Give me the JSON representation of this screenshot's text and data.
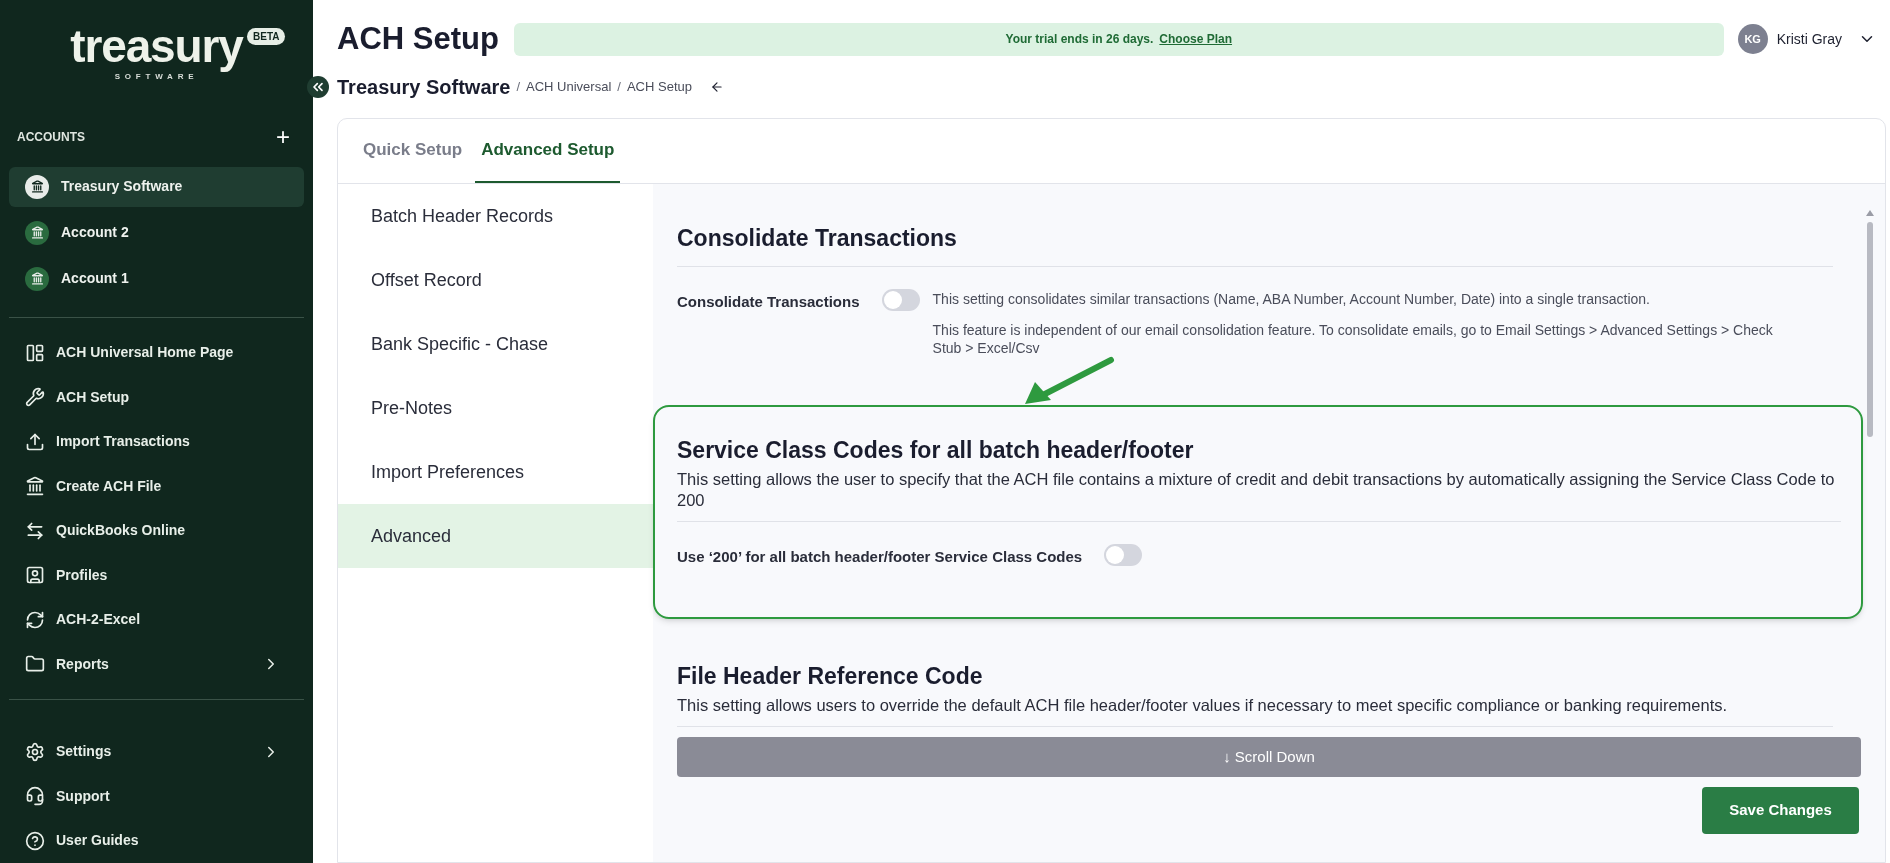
{
  "logo": {
    "wordmark": "treasury",
    "tagline": "SOFTWARE",
    "badge": "BETA"
  },
  "sidebar": {
    "accounts_heading": "ACCOUNTS",
    "add_button": "+",
    "accounts": [
      {
        "label": "Treasury Software",
        "selected": true
      },
      {
        "label": "Account 2",
        "selected": false
      },
      {
        "label": "Account 1",
        "selected": false
      }
    ],
    "nav": [
      {
        "label": "ACH Universal Home Page",
        "has_submenu": false
      },
      {
        "label": "ACH Setup",
        "has_submenu": false
      },
      {
        "label": "Import Transactions",
        "has_submenu": false
      },
      {
        "label": "Create ACH File",
        "has_submenu": false
      },
      {
        "label": "QuickBooks Online",
        "has_submenu": false
      },
      {
        "label": "Profiles",
        "has_submenu": false
      },
      {
        "label": "ACH-2-Excel",
        "has_submenu": false
      },
      {
        "label": "Reports",
        "has_submenu": true
      }
    ],
    "bottom_nav": [
      {
        "label": "Settings",
        "has_submenu": true
      },
      {
        "label": "Support",
        "has_submenu": false
      },
      {
        "label": "User Guides",
        "has_submenu": false
      }
    ]
  },
  "header": {
    "title": "ACH Setup",
    "trial_text": "Your trial ends in 26 days.",
    "trial_link": "Choose Plan",
    "user_initials": "KG",
    "user_name": "Kristi Gray"
  },
  "breadcrumb": {
    "root": "Treasury Software",
    "separator": "/",
    "items": [
      "ACH Universal",
      "ACH Setup"
    ]
  },
  "tabs": [
    {
      "label": "Quick Setup",
      "selected": false
    },
    {
      "label": "Advanced Setup",
      "selected": true
    }
  ],
  "side_menu": [
    {
      "label": "Batch Header Records",
      "selected": false
    },
    {
      "label": "Offset Record",
      "selected": false
    },
    {
      "label": "Bank Specific - Chase",
      "selected": false
    },
    {
      "label": "Pre-Notes",
      "selected": false
    },
    {
      "label": "Import Preferences",
      "selected": false
    },
    {
      "label": "Advanced",
      "selected": true
    }
  ],
  "sections": [
    {
      "title": "Consolidate Transactions",
      "highlighted": false,
      "setting": {
        "label": "Consolidate Transactions",
        "on": false,
        "notes": [
          "This setting consolidates similar transactions (Name, ABA Number, Account Number, Date) into a single transaction.",
          "This feature is independent of our email consolidation feature. To consolidate emails, go to Email Settings > Advanced Settings > Check Stub > Excel/Csv"
        ]
      }
    },
    {
      "title": "Service Class Codes for all batch header/footer",
      "highlighted": true,
      "description": "This setting allows the user to specify that the ACH file contains a mixture of credit and debit transactions by automatically assigning the Service Class Code to 200",
      "setting": {
        "label": "Use ‘200’ for all batch header/footer Service Class Codes",
        "on": false
      }
    },
    {
      "title": "File Header Reference Code",
      "highlighted": false,
      "description": "This setting allows users to override the default ACH file header/footer values if necessary to meet specific compliance or banking requirements."
    }
  ],
  "scroll_button": "↓ Scroll Down",
  "save_button": "Save Changes"
}
